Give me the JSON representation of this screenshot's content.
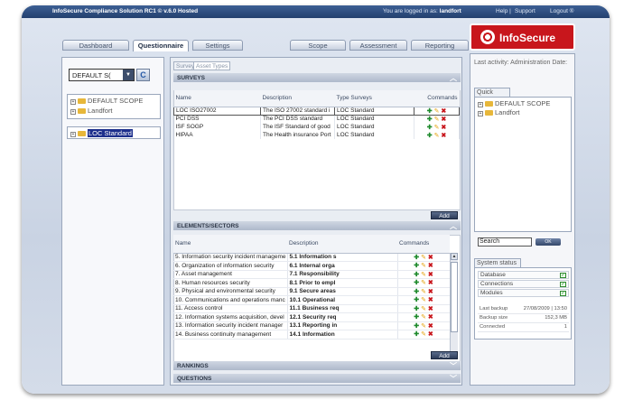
{
  "topbar": {
    "title": "InfoSecure Compliance Solution RC1 © v.6.0 Hosted",
    "login_prefix": "You are logged in as:",
    "user": "landfort",
    "help": "Help |",
    "support": "Support",
    "logout": "Logout ®"
  },
  "logo": {
    "text": "InfoSecure"
  },
  "tabs": [
    {
      "label": "Dashboard"
    },
    {
      "label": "Questionnaire"
    },
    {
      "label": "Settings"
    },
    {
      "label": "Scope"
    },
    {
      "label": "Assessment"
    },
    {
      "label": "Reporting"
    }
  ],
  "left": {
    "scope_select": "DEFAULT S(",
    "refresh_icon": "C",
    "tree": [
      {
        "label": "DEFAULT SCOPE"
      },
      {
        "label": "Landfort"
      }
    ],
    "tree2": [
      {
        "label": "LOC Standard"
      }
    ]
  },
  "main": {
    "subtabs": [
      "Surveys",
      "Asset Types"
    ],
    "surveys": {
      "section_title": "SURVEYS",
      "columns": [
        "Name",
        "Description",
        "Type Surveys",
        "Commands"
      ],
      "rows": [
        {
          "name": "LOC ISO27002",
          "desc": "The ISO 27002 standard i",
          "type": "LOC Standard"
        },
        {
          "name": "PCI DSS",
          "desc": "The PCI DSS standard",
          "type": "LOC Standard"
        },
        {
          "name": "ISF SOGP",
          "desc": "The ISF Standard of good",
          "type": "LOC Standard"
        },
        {
          "name": "HIPAA",
          "desc": "The Health insurance Port",
          "type": "LOC Standard"
        }
      ],
      "add_label": "Add"
    },
    "elements": {
      "section_title": "ELEMENTS/SECTORS",
      "columns": [
        "Name",
        "Description",
        "Commands"
      ],
      "rows": [
        {
          "name": "5. Information security incident manageme",
          "desc": "5.1 Information s"
        },
        {
          "name": "6. Organization of information security",
          "desc": "6.1 Internal orga"
        },
        {
          "name": "7. Asset management",
          "desc": "7.1 Responsibility"
        },
        {
          "name": "8. Human resources security",
          "desc": "8.1 Prior to empl"
        },
        {
          "name": "9. Physical and environmental security",
          "desc": "9.1 Secure areas"
        },
        {
          "name": "10. Communications and operations manc",
          "desc": "10.1 Operational"
        },
        {
          "name": "11. Access control",
          "desc": "11.1 Business req"
        },
        {
          "name": "12. Information systems acquisition, devel",
          "desc": "12.1 Security req"
        },
        {
          "name": "13. Information security incident manager",
          "desc": "13.1 Reporting in"
        },
        {
          "name": "14. Business continuity management",
          "desc": "14.1 Information"
        }
      ],
      "add_label": "Add"
    },
    "rankings_title": "RANKINGS",
    "questions_title": "QUESTIONS"
  },
  "right": {
    "last_activity": "Last activity: Administration Date:",
    "quick_menu": "Quick menu",
    "quick_tree": [
      {
        "label": "DEFAULT SCOPE"
      },
      {
        "label": "Landfort"
      }
    ],
    "search_value": "Search",
    "search_button": "OK",
    "system_status": "System status",
    "status_rows": [
      {
        "label": "Database",
        "ok": true
      },
      {
        "label": "Connections",
        "ok": true
      },
      {
        "label": "Modules",
        "ok": true
      }
    ],
    "info_rows": [
      {
        "label": "Last backup",
        "value": "27/08/2009 | 13:50"
      },
      {
        "label": "Backup size",
        "value": "152,3 MB"
      },
      {
        "label": "Connected",
        "value": "1"
      }
    ]
  },
  "colors": {
    "brand": "#c8161c",
    "topbar": "#2b4a7c",
    "selection": "#1c2f8c"
  }
}
